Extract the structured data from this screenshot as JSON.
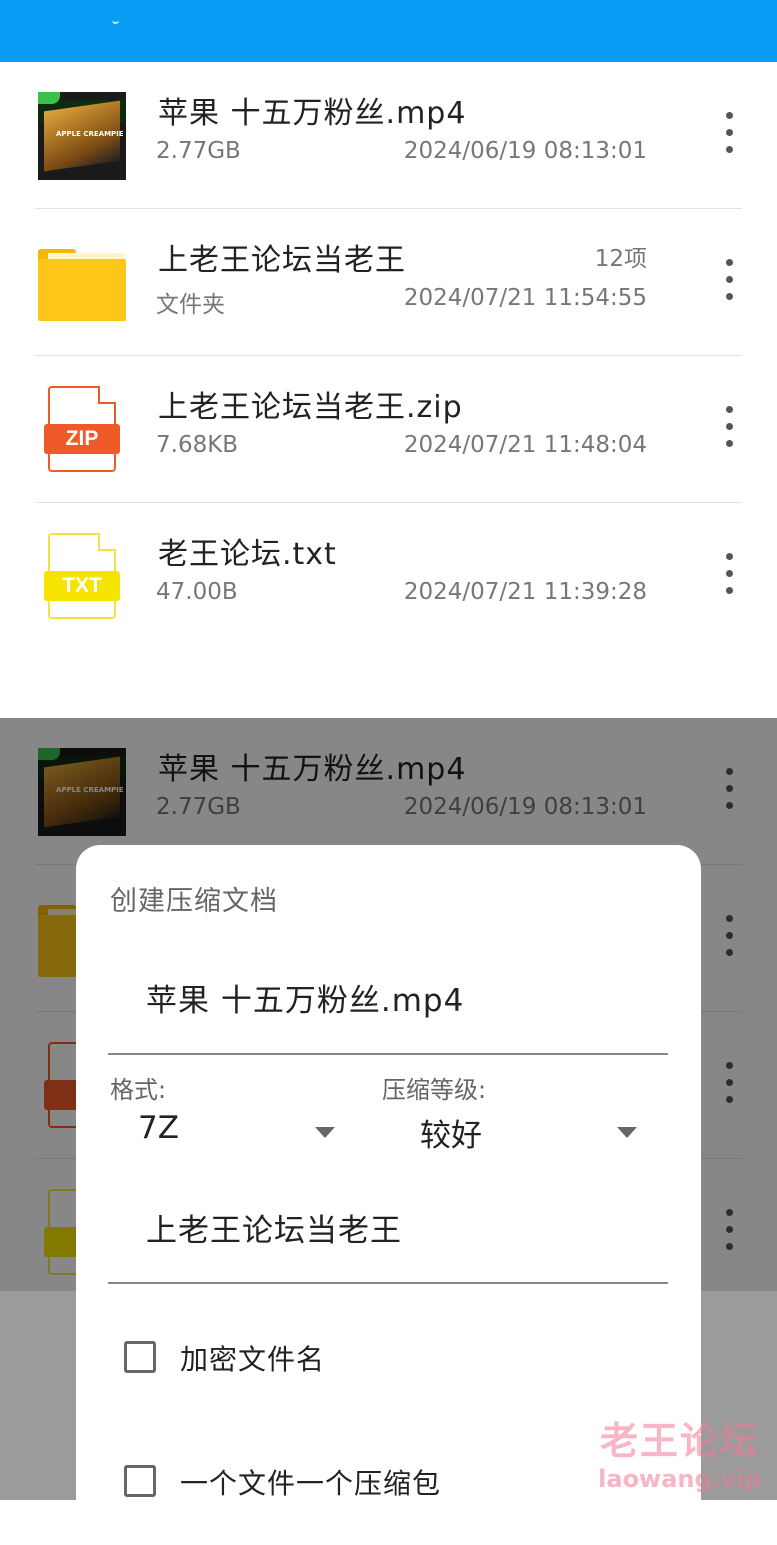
{
  "files": [
    {
      "name": "苹果 十五万粉丝.mp4",
      "meta": "2.77GB",
      "count": "",
      "date": "2024/06/19 08:13:01",
      "type": "video",
      "thumb_text": "APPLE CREAMPIE"
    },
    {
      "name": "上老王论坛当老王",
      "meta": "文件夹",
      "count": "12项",
      "date": "2024/07/21 11:54:55",
      "type": "folder",
      "thumb_text": ""
    },
    {
      "name": "上老王论坛当老王.zip",
      "meta": "7.68KB",
      "count": "",
      "date": "2024/07/21 11:48:04",
      "type": "zip",
      "thumb_text": "ZIP"
    },
    {
      "name": "老王论坛.txt",
      "meta": "47.00B",
      "count": "",
      "date": "2024/07/21 11:39:28",
      "type": "txt",
      "thumb_text": "TXT"
    }
  ],
  "dialog": {
    "title": "创建压缩文档",
    "archive_name": "苹果 十五万粉丝.mp4",
    "format_label": "格式:",
    "format_value": "7Z",
    "level_label": "压缩等级:",
    "level_value": "较好",
    "password": "上老王论坛当老王",
    "encrypt_names_label": "加密文件名",
    "one_archive_per_file_label": "一个文件一个压缩包"
  },
  "watermark": {
    "line1": "老王论坛",
    "line2": "laowang.vip"
  },
  "colors": {
    "appbar": "#0a9cf5",
    "zip": "#f05a28",
    "txt": "#f5e400",
    "folder": "#ffc61a"
  }
}
